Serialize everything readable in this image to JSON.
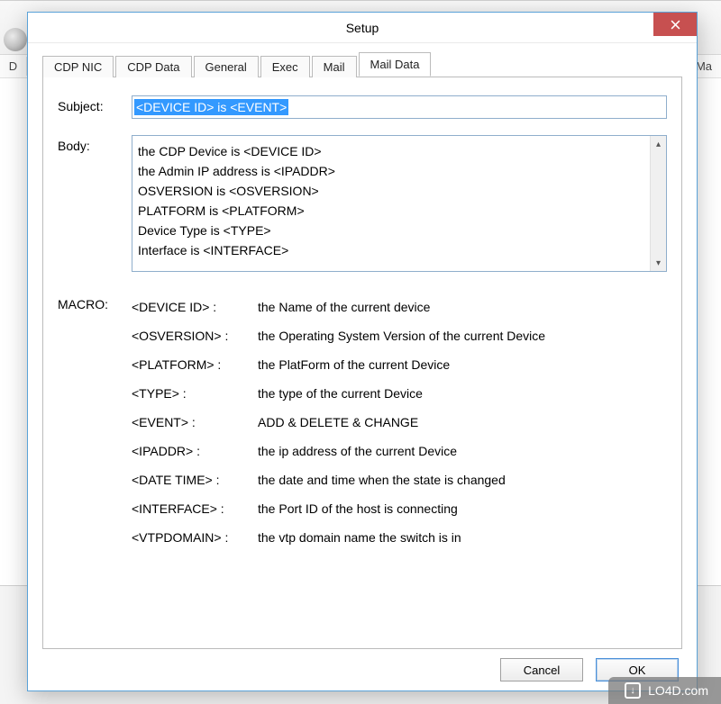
{
  "background": {
    "left_col_header": "D",
    "right_col_header": "Ma"
  },
  "dialog": {
    "title": "Setup",
    "tabs": [
      {
        "label": "CDP NIC"
      },
      {
        "label": "CDP Data"
      },
      {
        "label": "General"
      },
      {
        "label": "Exec"
      },
      {
        "label": "Mail"
      },
      {
        "label": "Mail Data"
      }
    ],
    "active_tab": "Mail Data",
    "subject_label": "Subject:",
    "subject_value": "<DEVICE ID> is <EVENT>",
    "body_label": "Body:",
    "body_lines": [
      "the CDP Device is <DEVICE ID>",
      "the Admin IP address is <IPADDR>",
      "OSVERSION is <OSVERSION>",
      "PLATFORM is <PLATFORM>",
      "Device Type is <TYPE>",
      "Interface is <INTERFACE>"
    ],
    "macro_label": "MACRO:",
    "macros": [
      {
        "key": "<DEVICE ID> :",
        "desc": "the Name of the current device"
      },
      {
        "key": "<OSVERSION> :",
        "desc": "the Operating System Version of the current Device"
      },
      {
        "key": "<PLATFORM> :",
        "desc": "the PlatForm of the current Device"
      },
      {
        "key": "<TYPE> :",
        "desc": "the type of the current Device"
      },
      {
        "key": "<EVENT> :",
        "desc": "ADD & DELETE & CHANGE"
      },
      {
        "key": "<IPADDR> :",
        "desc": "the ip address of the current Device"
      },
      {
        "key": "<DATE TIME> :",
        "desc": "the date and time when the state is changed"
      },
      {
        "key": "<INTERFACE> :",
        "desc": "the Port ID of the host is connecting"
      },
      {
        "key": "<VTPDOMAIN> :",
        "desc": "the vtp domain name the switch is in"
      }
    ],
    "buttons": {
      "cancel": "Cancel",
      "ok": "OK"
    }
  },
  "watermark": "LO4D.com"
}
